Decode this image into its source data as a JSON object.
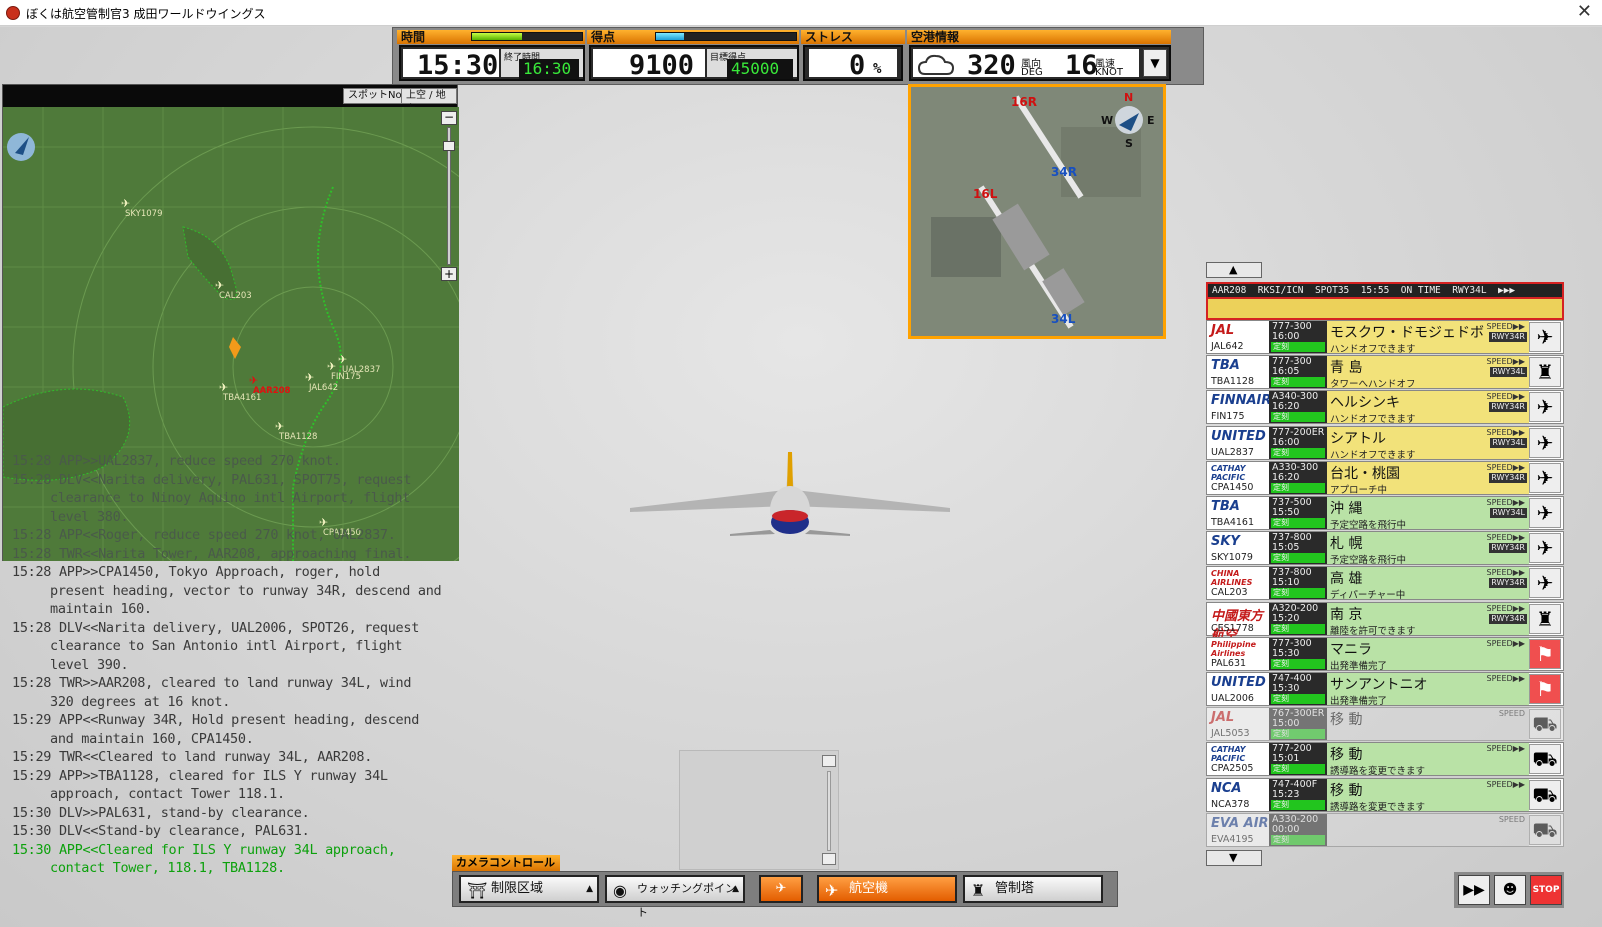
{
  "window": {
    "title": "ぼくは航空管制官3 成田ワールドウイングス",
    "close_icon": "close-icon"
  },
  "hud": {
    "time_label": "時間",
    "time_value": "15:30",
    "end_time_label": "終了時間",
    "end_time_value": "16:30",
    "time_progress": 0.45,
    "score_label": "得点",
    "score_value": "9100",
    "target_score_label": "目標得点",
    "target_score_value": "45000",
    "score_progress": 0.2,
    "stress_label": "ストレス",
    "stress_value": "0",
    "stress_unit": "%",
    "airport_info_label": "空港情報",
    "wind_dir_value": "320",
    "wind_dir_label": "風向",
    "wind_dir_unit": "DEG",
    "wind_speed_value": "16",
    "wind_speed_label": "風速",
    "wind_speed_unit": "KNOT",
    "weather_icon": "cloud-icon"
  },
  "map": {
    "spot_button": "スポットNo",
    "air_ground_button": "上空 / 地上",
    "aircraft": [
      {
        "callsign": "SKY1079"
      },
      {
        "callsign": "CAL203"
      },
      {
        "callsign": "AAR208"
      },
      {
        "callsign": "TBA4161"
      },
      {
        "callsign": "FIN175"
      },
      {
        "callsign": "UAL2837"
      },
      {
        "callsign": "JAL642"
      },
      {
        "callsign": "TBA1128"
      },
      {
        "callsign": "CPA1450"
      }
    ]
  },
  "log": [
    {
      "text": "15:28 APP>>UAL2837, reduce speed 270 knot.",
      "style": "dim"
    },
    {
      "text": "15:28 DLV<<Narita delivery, PAL631, SPOT75, request clearance to Ninoy Aquino intl Airport, flight level 380.",
      "style": "dim"
    },
    {
      "text": "15:28 APP<<Roger, reduce speed 270 knot, UAL2837.",
      "style": "dim"
    },
    {
      "text": "15:28 TWR<<Narita Tower, AAR208, approaching final.",
      "style": "dim"
    },
    {
      "text": "15:28 APP>>CPA1450, Tokyo Approach, roger, hold present heading, vector to runway 34R, descend and maintain 160.",
      "style": "normal"
    },
    {
      "text": "15:28 DLV<<Narita delivery, UAL2006, SPOT26, request clearance to San Antonio intl Airport, flight level 390.",
      "style": "normal"
    },
    {
      "text": "15:28 TWR>>AAR208, cleared to land runway 34L, wind 320 degrees at 16 knot.",
      "style": "normal"
    },
    {
      "text": "15:29 APP<<Runway 34R, Hold present heading, descend and maintain 160, CPA1450.",
      "style": "normal"
    },
    {
      "text": "15:29 TWR<<Cleared to land runway 34L, AAR208.",
      "style": "normal"
    },
    {
      "text": "15:29 APP>>TBA1128, cleared for ILS Y runway 34L approach, contact Tower 118.1.",
      "style": "normal"
    },
    {
      "text": "15:30 DLV>>PAL631, stand-by clearance.",
      "style": "normal"
    },
    {
      "text": "15:30 DLV<<Stand-by clearance, PAL631.",
      "style": "normal"
    },
    {
      "text": "15:30 APP<<Cleared for ILS Y runway 34L approach, contact Tower, 118.1, TBA1128.",
      "style": "green"
    }
  ],
  "airport_map": {
    "north": "N",
    "south": "S",
    "east": "E",
    "west": "W",
    "runways": [
      "16R",
      "34L",
      "16L",
      "34R"
    ]
  },
  "strip_header": "AAR208  RKSI/ICN  SPOT35  15:55  ON TIME  RWY34L  ▶▶▶",
  "strips": [
    {
      "brand": "JAL",
      "callsign": "JAL642",
      "type": "777-300",
      "time": "16:00",
      "status": "定刻",
      "dest": "モスクワ・ドモジェドボ",
      "msg": "ハンドオフできます",
      "speed": "SPEED▶▶",
      "rwy": "RWY34R",
      "style": "yellow",
      "action_icon": "takeoff-icon",
      "action": "✈"
    },
    {
      "brand": "TBA",
      "callsign": "TBA1128",
      "type": "777-300",
      "time": "16:05",
      "status": "定刻",
      "dest": "青 島",
      "msg": "タワーへハンドオフ",
      "speed": "SPEED▶▶",
      "rwy": "RWY34L",
      "style": "yellow",
      "action_icon": "tower-icon",
      "action": "♜"
    },
    {
      "brand": "FINNAIR",
      "callsign": "FIN175",
      "type": "A340-300",
      "time": "16:20",
      "status": "定刻",
      "dest": "ヘルシンキ",
      "msg": "ハンドオフできます",
      "speed": "SPEED▶▶",
      "rwy": "RWY34R",
      "style": "yellow",
      "action_icon": "takeoff-icon",
      "action": "✈"
    },
    {
      "brand": "UNITED",
      "callsign": "UAL2837",
      "type": "777-200ER",
      "time": "16:00",
      "status": "定刻",
      "dest": "シアトル",
      "msg": "ハンドオフできます",
      "speed": "SPEED▶▶",
      "rwy": "RWY34L",
      "style": "yellow",
      "action_icon": "takeoff-icon",
      "action": "✈"
    },
    {
      "brand": "CATHAY PACIFIC",
      "callsign": "CPA1450",
      "type": "A330-300",
      "time": "16:20",
      "status": "定刻",
      "dest": "台北・桃園",
      "msg": "アプローチ中",
      "speed": "SPEED▶▶",
      "rwy": "RWY34R",
      "style": "yellow",
      "action_icon": "plane-icon",
      "action": "✈"
    },
    {
      "brand": "TBA",
      "callsign": "TBA4161",
      "type": "737-500",
      "time": "15:50",
      "status": "定刻",
      "dest": "沖 縄",
      "msg": "予定空路を飛行中",
      "speed": "SPEED▶▶",
      "rwy": "RWY34L",
      "style": "green",
      "action_icon": "plane-icon",
      "action": "✈"
    },
    {
      "brand": "SKY",
      "callsign": "SKY1079",
      "type": "737-800",
      "time": "15:05",
      "status": "定刻",
      "dest": "札 幌",
      "msg": "予定空路を飛行中",
      "speed": "SPEED▶▶",
      "rwy": "RWY34R",
      "style": "green",
      "action_icon": "plane-icon",
      "action": "✈"
    },
    {
      "brand": "CHINA AIRLINES",
      "callsign": "CAL203",
      "type": "737-800",
      "time": "15:10",
      "status": "定刻",
      "dest": "高 雄",
      "msg": "ディパーチャー中",
      "speed": "SPEED▶▶",
      "rwy": "RWY34R",
      "style": "green",
      "action_icon": "plane-icon",
      "action": "✈"
    },
    {
      "brand": "中國東方航空",
      "callsign": "CES1778",
      "type": "A320-200",
      "time": "15:20",
      "status": "定刻",
      "dest": "南 京",
      "msg": "離陸を許可できます",
      "speed": "SPEED▶▶",
      "rwy": "RWY34R",
      "style": "green",
      "action_icon": "tower-icon",
      "action": "♜"
    },
    {
      "brand": "Philippine Airlines",
      "callsign": "PAL631",
      "type": "777-300",
      "time": "15:30",
      "status": "定刻",
      "dest": "マニラ",
      "msg": "出発準備完了",
      "speed": "SPEED▶▶",
      "rwy": "",
      "style": "green red",
      "action_icon": "pushback-icon",
      "action": "⚑"
    },
    {
      "brand": "UNITED",
      "callsign": "UAL2006",
      "type": "747-400",
      "time": "15:30",
      "status": "定刻",
      "dest": "サンアントニオ",
      "msg": "出発準備完了",
      "speed": "SPEED▶▶",
      "rwy": "",
      "style": "green red",
      "action_icon": "pushback-icon",
      "action": "⚑"
    },
    {
      "brand": "JAL",
      "callsign": "JAL5053",
      "type": "767-300ER",
      "time": "15:00",
      "status": "定刻",
      "dest": "移 動",
      "msg": "",
      "speed": "SPEED",
      "rwy": "",
      "style": "gray",
      "action_icon": "tug-icon",
      "action": "⛟"
    },
    {
      "brand": "CATHAY PACIFIC",
      "callsign": "CPA2505",
      "type": "777-200",
      "time": "15:01",
      "status": "定刻",
      "dest": "移 動",
      "msg": "誘導路を変更できます",
      "speed": "SPEED▶▶",
      "rwy": "",
      "style": "green",
      "action_icon": "tug-icon",
      "action": "⛟"
    },
    {
      "brand": "NCA",
      "callsign": "NCA378",
      "type": "747-400F",
      "time": "15:23",
      "status": "定刻",
      "dest": "移 動",
      "msg": "誘導路を変更できます",
      "speed": "SPEED▶▶",
      "rwy": "",
      "style": "green",
      "action_icon": "tug-icon",
      "action": "⛟"
    },
    {
      "brand": "EVA AIR",
      "callsign": "EVA4195",
      "type": "A330-200",
      "time": "00:00",
      "status": "定刻",
      "dest": "",
      "msg": "",
      "speed": "SPEED",
      "rwy": "",
      "style": "gray",
      "action_icon": "tug-icon",
      "action": "⛟"
    }
  ],
  "camera": {
    "label": "カメラコントロール",
    "restricted_area": "制限区域",
    "watching_point": "ウォッチングポイント",
    "aircraft": "航空機",
    "tower": "管制塔"
  },
  "bottom_right": {
    "ff": "▶▶",
    "stop": "STOP"
  },
  "colors": {
    "accent": "#ff9c1a",
    "strip_yellow": "#f2e27a",
    "strip_green": "#b9e2a6",
    "radar_green": "#4f7a3a"
  }
}
